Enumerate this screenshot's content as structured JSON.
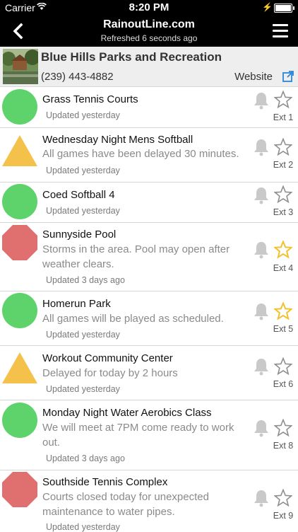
{
  "status_bar": {
    "carrier": "Carrier",
    "time": "8:20 PM"
  },
  "header": {
    "title": "RainoutLine.com",
    "subtitle": "Refreshed 6 seconds ago"
  },
  "organization": {
    "name": "Blue Hills Parks and Recreation",
    "phone": "(239) 443-4882",
    "website_label": "Website"
  },
  "colors": {
    "open": "#5fd36b",
    "delayed": "#f4c24a",
    "closed": "#e07070",
    "favorite_star": "#f2c12e"
  },
  "facilities": [
    {
      "title": "Grass Tennis Courts",
      "message": "",
      "updated": "Updated yesterday",
      "ext": "Ext 1",
      "status": "open",
      "favorite": false
    },
    {
      "title": "Wednesday Night Mens Softball",
      "message": "All games have been delayed 30 minutes.",
      "updated": "Updated yesterday",
      "ext": "Ext 2",
      "status": "delayed",
      "favorite": false
    },
    {
      "title": "Coed Softball 4",
      "message": "",
      "updated": "Updated yesterday",
      "ext": "Ext 3",
      "status": "open",
      "favorite": false
    },
    {
      "title": "Sunnyside Pool",
      "message": "Storms in the area. Pool may open after weather clears.",
      "updated": "Updated 3 days ago",
      "ext": "Ext 4",
      "status": "closed",
      "favorite": true
    },
    {
      "title": "Homerun Park",
      "message": "All games will be played as scheduled.",
      "updated": "Updated yesterday",
      "ext": "Ext 5",
      "status": "open",
      "favorite": true
    },
    {
      "title": "Workout Community Center",
      "message": "Delayed for today by 2 hours",
      "updated": "Updated yesterday",
      "ext": "Ext 6",
      "status": "delayed",
      "favorite": false
    },
    {
      "title": "Monday Night Water Aerobics Class",
      "message": "We will meet at 7PM come ready to work out.",
      "updated": "Updated 3 days ago",
      "ext": "Ext 8",
      "status": "open",
      "favorite": false
    },
    {
      "title": "Southside Tennis Complex",
      "message": "Courts closed today for unexpected maintenance to water pipes.",
      "updated": "Updated yesterday",
      "ext": "Ext 9",
      "status": "closed",
      "favorite": false
    }
  ]
}
